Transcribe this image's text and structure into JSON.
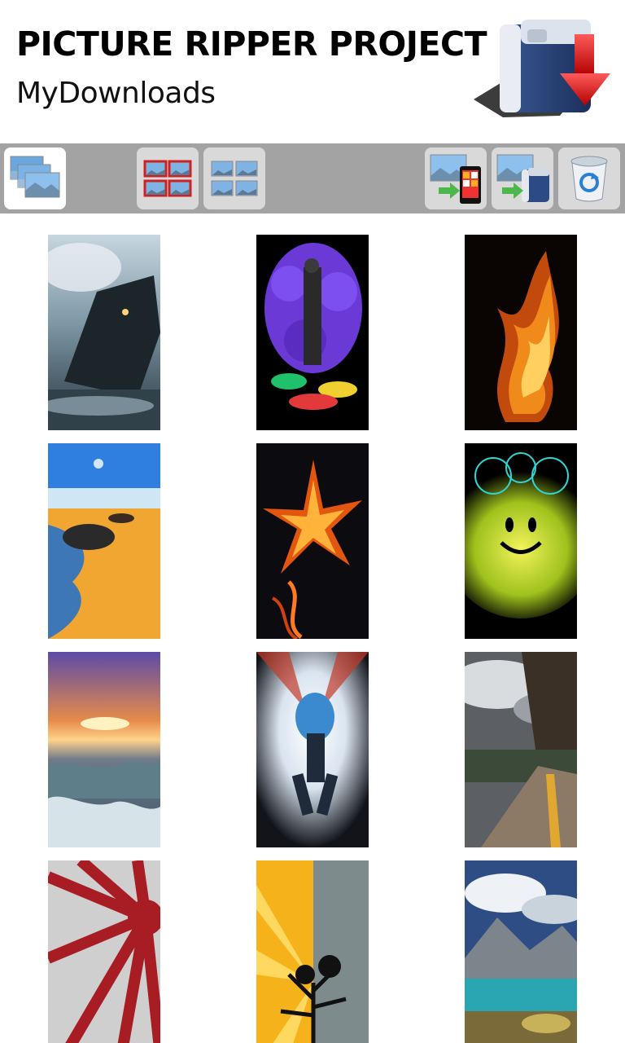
{
  "header": {
    "app_title": "PICTURE RIPPER PROJECT",
    "page_title": "MyDownloads",
    "logo_icon": "folder-download-icon"
  },
  "toolbar": {
    "buttons": [
      {
        "icon": "image-stack-icon",
        "active": true
      },
      {
        "icon": "select-grid-red-icon",
        "active": false
      },
      {
        "icon": "grid-view-icon",
        "active": false
      },
      {
        "icon": "save-to-phone-icon",
        "active": false
      },
      {
        "icon": "save-to-folder-icon",
        "active": false
      },
      {
        "icon": "recycle-bin-icon",
        "active": false
      }
    ]
  },
  "gallery": {
    "images": [
      {
        "subject": "train-in-clouds"
      },
      {
        "subject": "graffiti-purple-sneakers"
      },
      {
        "subject": "fire-flames"
      },
      {
        "subject": "beach-rocks-shore"
      },
      {
        "subject": "flaming-flower"
      },
      {
        "subject": "glowing-smiley"
      },
      {
        "subject": "sunset-waterfall-sea"
      },
      {
        "subject": "dancer-burst"
      },
      {
        "subject": "mountain-road-clouds"
      },
      {
        "subject": "rising-sun-rays"
      },
      {
        "subject": "tree-split-sunburst"
      },
      {
        "subject": "mountain-lake"
      }
    ]
  }
}
